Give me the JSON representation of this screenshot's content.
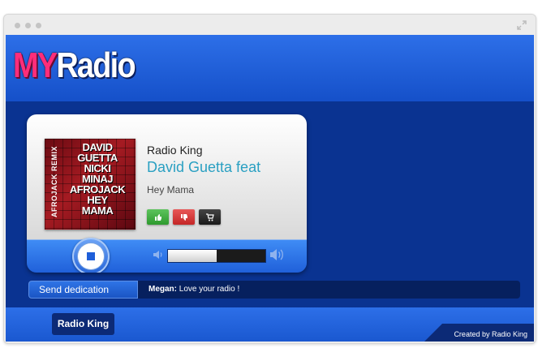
{
  "logo": {
    "part1": "MY",
    "part2": "Radio"
  },
  "player": {
    "station": "Radio King",
    "artist": "David Guetta feat",
    "song": "Hey Mama",
    "cover": {
      "lines": [
        "DAVID",
        "GUETTA",
        "NICKI",
        "MINAJ",
        "AFROJACK",
        "HEY",
        "MAMA"
      ],
      "side": "AFROJACK REMIX"
    },
    "volume": 0.5
  },
  "dedication": {
    "button_label": "Send dedication",
    "author": "Megan:",
    "message": "Love your radio !"
  },
  "footer": {
    "button_label": "Radio King",
    "credit": "Created by Radio King"
  },
  "colors": {
    "brand_pink": "#ff2d7a",
    "accent_blue": "#2d6fe8",
    "artist_text": "#2aa0c2"
  }
}
